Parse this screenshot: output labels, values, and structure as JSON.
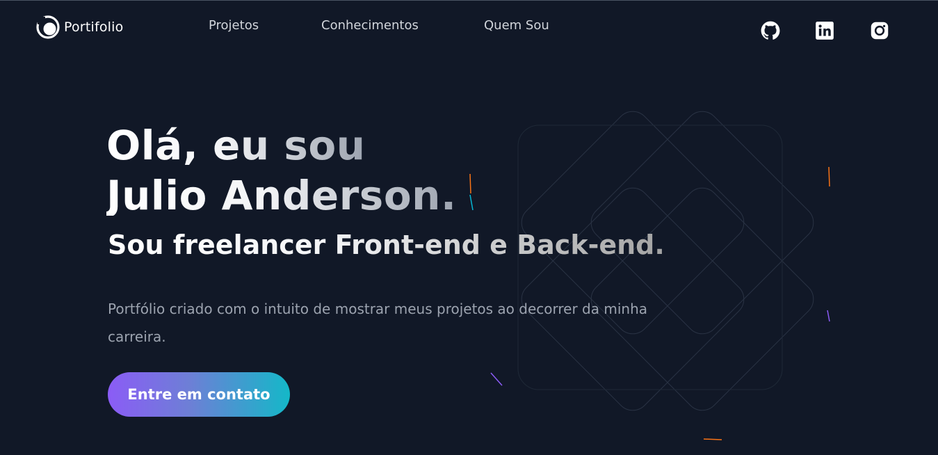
{
  "header": {
    "logo_text": "Portifolio",
    "nav": [
      {
        "label": "Projetos"
      },
      {
        "label": "Conhecimentos"
      },
      {
        "label": "Quem Sou"
      }
    ],
    "social_icons": [
      "github-icon",
      "linkedin-icon",
      "instagram-icon"
    ]
  },
  "hero": {
    "line1": "Olá, eu sou",
    "line2": "Julio Anderson.",
    "subtitle": "Sou freelancer Front-end e Back-end.",
    "description": "Portfólio criado com o intuito de mostrar meus projetos ao decorrer da minha carreira.",
    "cta_label": "Entre em contato"
  },
  "colors": {
    "background": "#111827",
    "nav_text": "#d1d5db",
    "description_text": "#9ca3af",
    "cta_gradient_start": "#8b5cf6",
    "cta_gradient_end": "#14b8c8"
  }
}
